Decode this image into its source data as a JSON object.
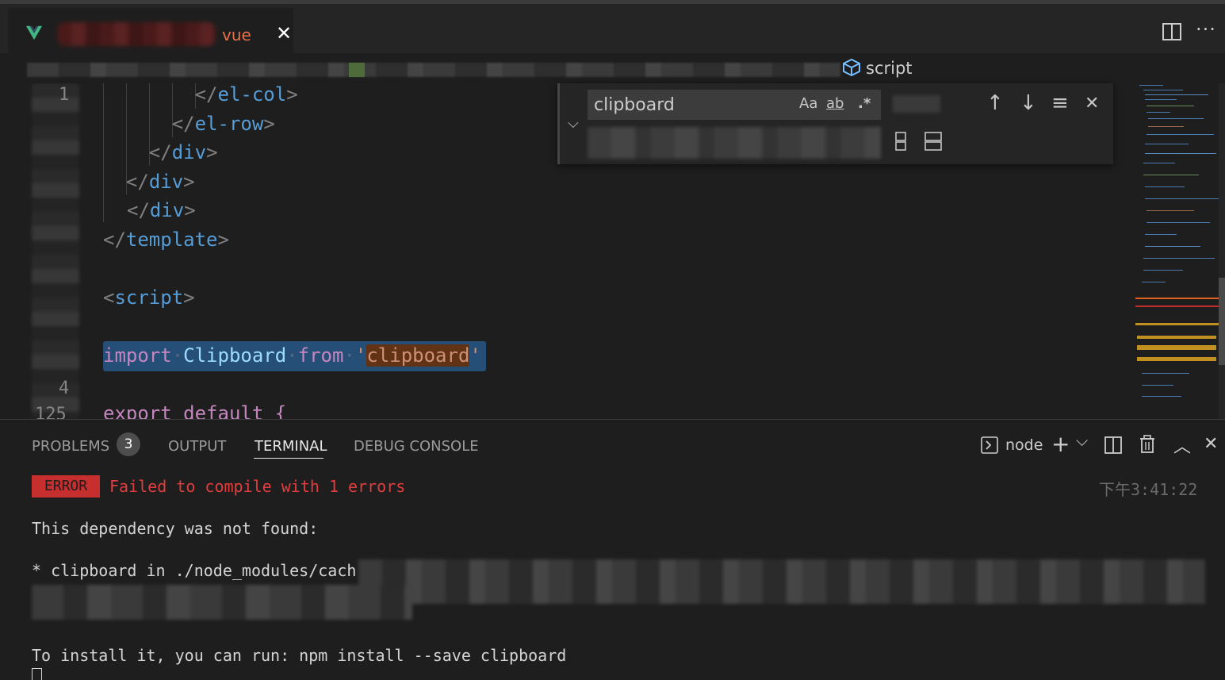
{
  "tab": {
    "label": "vue",
    "close_icon": "✕"
  },
  "breadcrumb": {
    "symbol": "script"
  },
  "editor": {
    "line_numbers": [
      "1",
      "4",
      "125"
    ],
    "code_lines": [
      {
        "indent": "        ",
        "bracket_open": "</",
        "tag": "el-col",
        "bracket_close": ">"
      },
      {
        "indent": "      ",
        "bracket_open": "</",
        "tag": "el-row",
        "bracket_close": ">"
      },
      {
        "indent": "    ",
        "bracket_open": "</",
        "tag": "div",
        "bracket_close": ">"
      },
      {
        "indent": "  ",
        "bracket_open": "</",
        "tag": "div",
        "bracket_close": ">"
      },
      {
        "indent": "",
        "bracket_open": "</",
        "tag": "div",
        "bracket_close": ">"
      },
      {
        "indent": "",
        "bracket_open": "</",
        "tag": "template",
        "bracket_close": ">"
      },
      {
        "indent": "",
        "bracket_open": "<",
        "tag": "script",
        "bracket_close": ">"
      }
    ],
    "import_line": {
      "kw_import": "import",
      "identifier": "Clipboard",
      "kw_from": "from",
      "quote": "'",
      "module": "clipboard"
    },
    "export_line": "export default {"
  },
  "find": {
    "query": "clipboard",
    "match_case": "Aa",
    "whole_word": "ab",
    "regex": ".*",
    "prev_icon": "↑",
    "next_icon": "↓",
    "selection_icon": "≡",
    "close_icon": "✕"
  },
  "panel": {
    "tabs": {
      "problems": "PROBLEMS",
      "output": "OUTPUT",
      "terminal": "TERMINAL",
      "debug": "DEBUG CONSOLE"
    },
    "problems_count": "3",
    "shell_name": "node",
    "add_icon": "+",
    "dropdown_icon": "⌵",
    "maximize_icon": "︿",
    "close_icon": "✕"
  },
  "terminal": {
    "error_badge": "ERROR",
    "error_message": "Failed to compile with 1 errors",
    "timestamp": "下午3:41:22",
    "dependency_line": "This dependency was not found:",
    "missing_line": "* clipboard in ./node_modules/cach",
    "install_line": "To install it, you can run: npm install --save clipboard"
  },
  "colors": {
    "editor_bg": "#1e1e1e",
    "tag": "#569cd6",
    "keyword": "#c586c0",
    "string": "#ce9178",
    "error": "#e03e3e"
  }
}
